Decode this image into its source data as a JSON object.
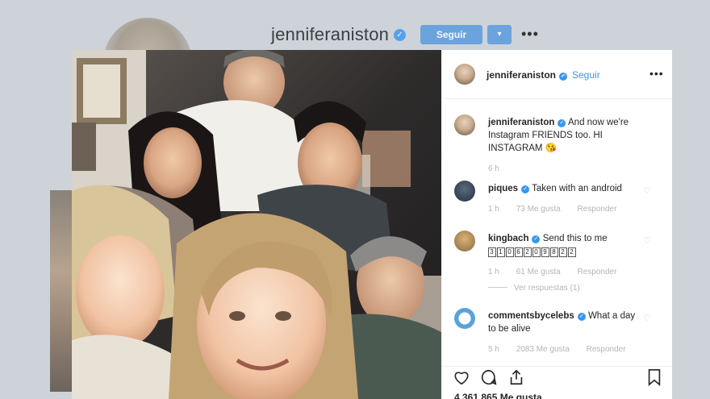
{
  "background_profile": {
    "username": "jenniferaniston",
    "verified_glyph": "✓",
    "follow_label": "Seguir",
    "dropdown_glyph": "▾",
    "more_glyph": "•••"
  },
  "post_header": {
    "username": "jenniferaniston",
    "verified_glyph": "✓",
    "separator": "•",
    "follow_label": "Seguir",
    "more_glyph": "•••"
  },
  "caption": {
    "username": "jenniferaniston",
    "text": "And now we're Instagram FRIENDS too. HI INSTAGRAM",
    "emoji": "😘",
    "time": "6 h"
  },
  "comments": [
    {
      "username": "piques",
      "text": "Taken with an android",
      "time": "1 h",
      "likes": "73 Me gusta",
      "reply": "Responder"
    },
    {
      "username": "kingbach",
      "text": "Send this to me",
      "code": "3106209822",
      "time": "1 h",
      "likes": "61 Me gusta",
      "reply": "Responder",
      "view_replies": "Ver respuestas (1)"
    },
    {
      "username": "commentsbycelebs",
      "text": "What a day to be alive",
      "time": "5 h",
      "likes": "2083 Me gusta",
      "reply": "Responder"
    }
  ],
  "actions": {
    "like_icon": "heart-icon",
    "comment_icon": "comment-icon",
    "share_icon": "share-icon",
    "save_icon": "bookmark-icon"
  },
  "likes_count": "4.361.865 Me gusta",
  "colors": {
    "accent": "#3897f0",
    "button": "#5a9be0",
    "muted": "#b5b5b5"
  }
}
